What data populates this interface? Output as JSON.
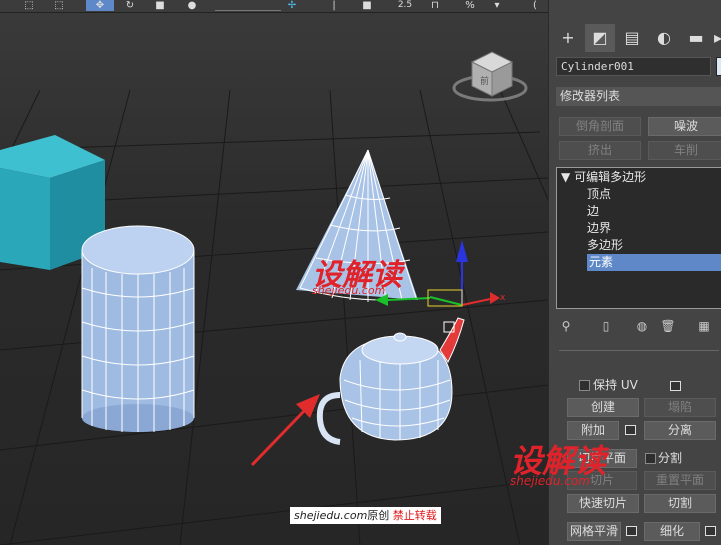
{
  "toolbar": {
    "items": [
      "select-region-icon",
      "window-crossing-icon",
      "move-icon",
      "rotate-icon",
      "scale-icon",
      "place-icon",
      "pivot-icon",
      "snap-icon",
      "angle-snap-icon",
      "percent-snap-icon",
      "spinner-snap-icon"
    ],
    "snap_value": "2.5"
  },
  "command_panel": {
    "tabs": [
      "create-tab",
      "modify-tab",
      "hierarchy-tab",
      "motion-tab",
      "display-tab"
    ],
    "object_name": "Cylinder001",
    "color_swatch": "#dde8f5",
    "modifier_list_label": "修改器列表",
    "modifier_buttons": [
      {
        "label": "倒角剖面",
        "enabled": false
      },
      {
        "label": "噪波",
        "enabled": true
      },
      {
        "label": "挤出",
        "enabled": false
      },
      {
        "label": "车削",
        "enabled": false
      }
    ],
    "stack": {
      "root": "可编辑多边形",
      "children": [
        "顶点",
        "边",
        "边界",
        "多边形",
        "元素"
      ],
      "selected": "元素"
    },
    "edit_geometry": {
      "preserve_uv_label": "保持 UV",
      "create_label": "创建",
      "collapse_label": "塌陷",
      "attach_label": "附加",
      "detach_label": "分离",
      "slice_plane_label": "切片平面",
      "split_label": "分割",
      "slice_label": "切片",
      "reset_plane_label": "重置平面",
      "quickslice_label": "快速切片",
      "cut_label": "切割",
      "meshsmooth_label": "网格平滑",
      "tessellate_label": "细化"
    }
  },
  "viewport": {
    "viewcube_label": "前",
    "gizmo_axes": [
      "x",
      "y",
      "z"
    ]
  },
  "watermark": {
    "site": "shejiedu.com",
    "original": "原创",
    "forbidden": "禁止转载",
    "logo_text": "设解读",
    "logo_sub": "shejiedu.com"
  },
  "colors": {
    "accent_selection": "#5e88c8",
    "object_blue": "#a9c3e6",
    "box_teal": "#2aa7b8",
    "arrow_red": "#e02c2c"
  }
}
